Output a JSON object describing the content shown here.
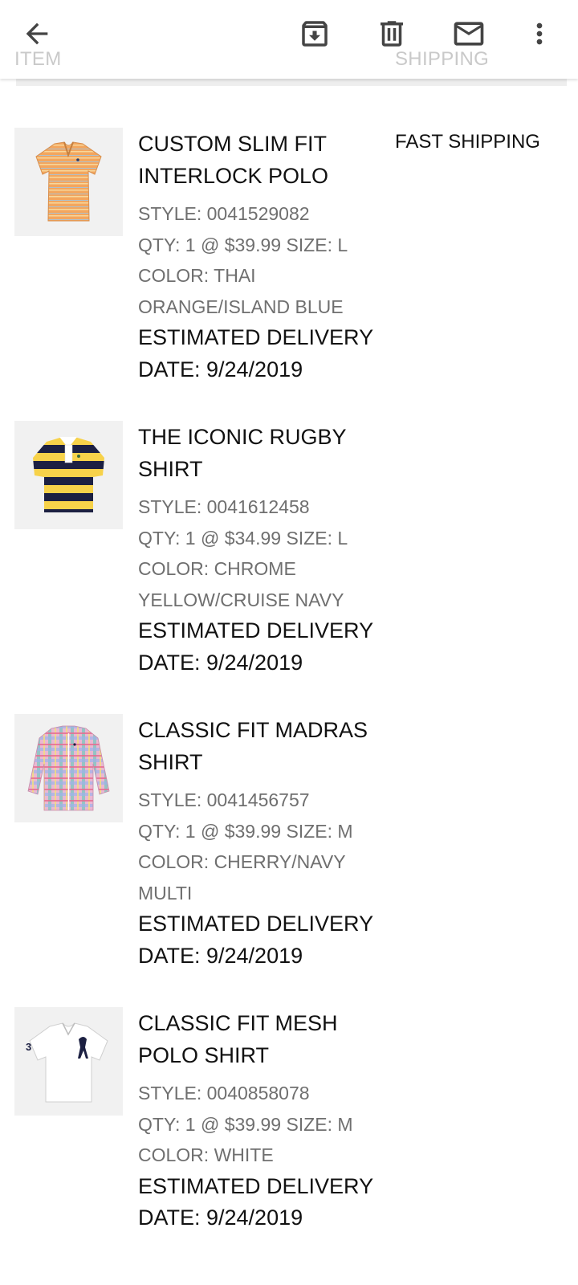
{
  "header": {
    "columns": {
      "item": "ITEM",
      "shipping": "SHIPPING"
    },
    "icons": [
      "back-arrow-icon",
      "archive-icon",
      "delete-icon",
      "mail-icon",
      "more-vert-icon"
    ]
  },
  "products": [
    {
      "title": "CUSTOM SLIM FIT INTERLOCK POLO",
      "style": "STYLE: 0041529082",
      "qty": "QTY: 1 @ $39.99 SIZE: L",
      "color": "COLOR: THAI ORANGE/ISLAND BLUE",
      "delivery": "ESTIMATED DELIVERY DATE: 9/24/2019",
      "shipping": "FAST SHIPPING"
    },
    {
      "title": "THE ICONIC RUGBY SHIRT",
      "style": "STYLE: 0041612458",
      "qty": "QTY: 1 @ $34.99 SIZE: L",
      "color": "COLOR: CHROME YELLOW/CRUISE NAVY",
      "delivery": "ESTIMATED DELIVERY DATE: 9/24/2019"
    },
    {
      "title": "CLASSIC FIT MADRAS SHIRT",
      "style": "STYLE: 0041456757",
      "qty": "QTY: 1 @ $39.99 SIZE: M",
      "color": "COLOR: CHERRY/NAVY MULTI",
      "delivery": "ESTIMATED DELIVERY DATE: 9/24/2019"
    },
    {
      "title": "CLASSIC FIT MESH POLO SHIRT",
      "style": "STYLE: 0040858078",
      "qty": "QTY: 1 @ $39.99 SIZE: M",
      "color": "COLOR: WHITE",
      "delivery": "ESTIMATED DELIVERY DATE: 9/24/2019",
      "image_text": "3"
    }
  ],
  "colors": {
    "polo_orange": "#f3a65e",
    "rugby_yellow": "#f7d24a",
    "rugby_navy": "#1c2042",
    "text_primary": "#111111",
    "text_secondary": "#6f6f6f"
  }
}
